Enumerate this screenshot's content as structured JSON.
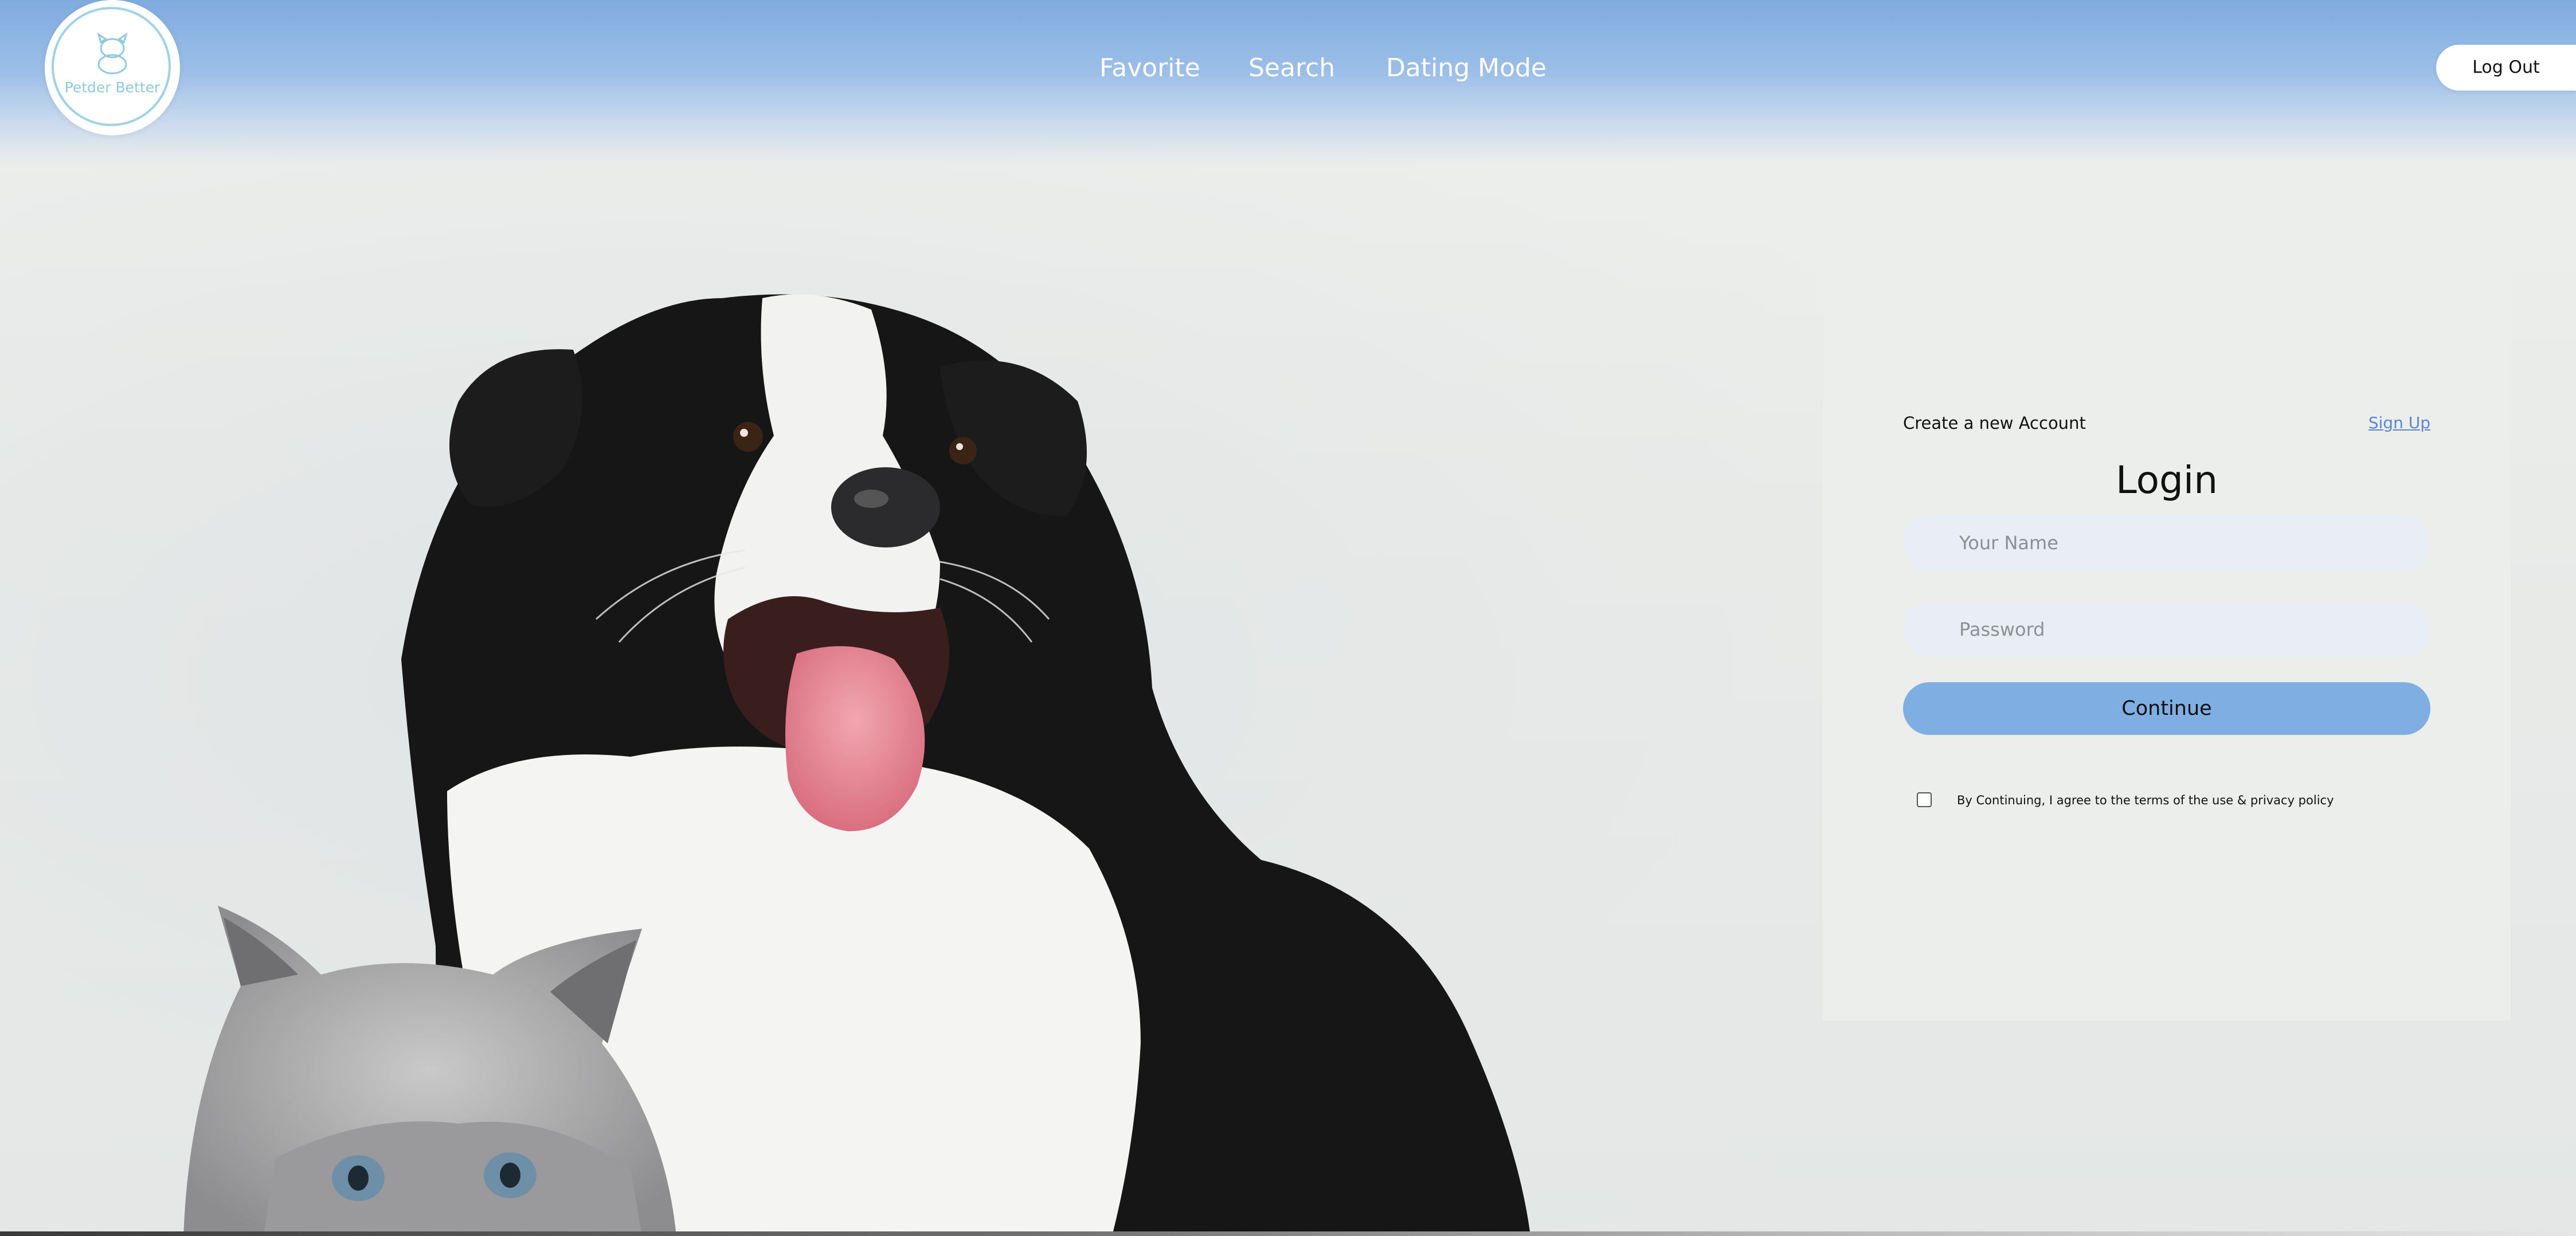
{
  "brand": {
    "logo_text": "Petder Better",
    "logo_icon": "cat-dog-icon",
    "accent": "#7faee3",
    "header_color": "#7fabdf"
  },
  "nav": {
    "items": [
      {
        "label": "Favorite"
      },
      {
        "label": "Search"
      },
      {
        "label": "Dating Mode"
      }
    ],
    "logout_label": "Log Out"
  },
  "login": {
    "create_account_label": "Create a new Account",
    "signup_link": "Sign Up",
    "title": "Login",
    "name_placeholder": "Your Name",
    "name_value": "",
    "password_placeholder": "Password",
    "password_value": "",
    "continue_label": "Continue",
    "terms_label": "By Continuing, I agree to the terms of the use & privacy policy",
    "terms_checked": false
  }
}
